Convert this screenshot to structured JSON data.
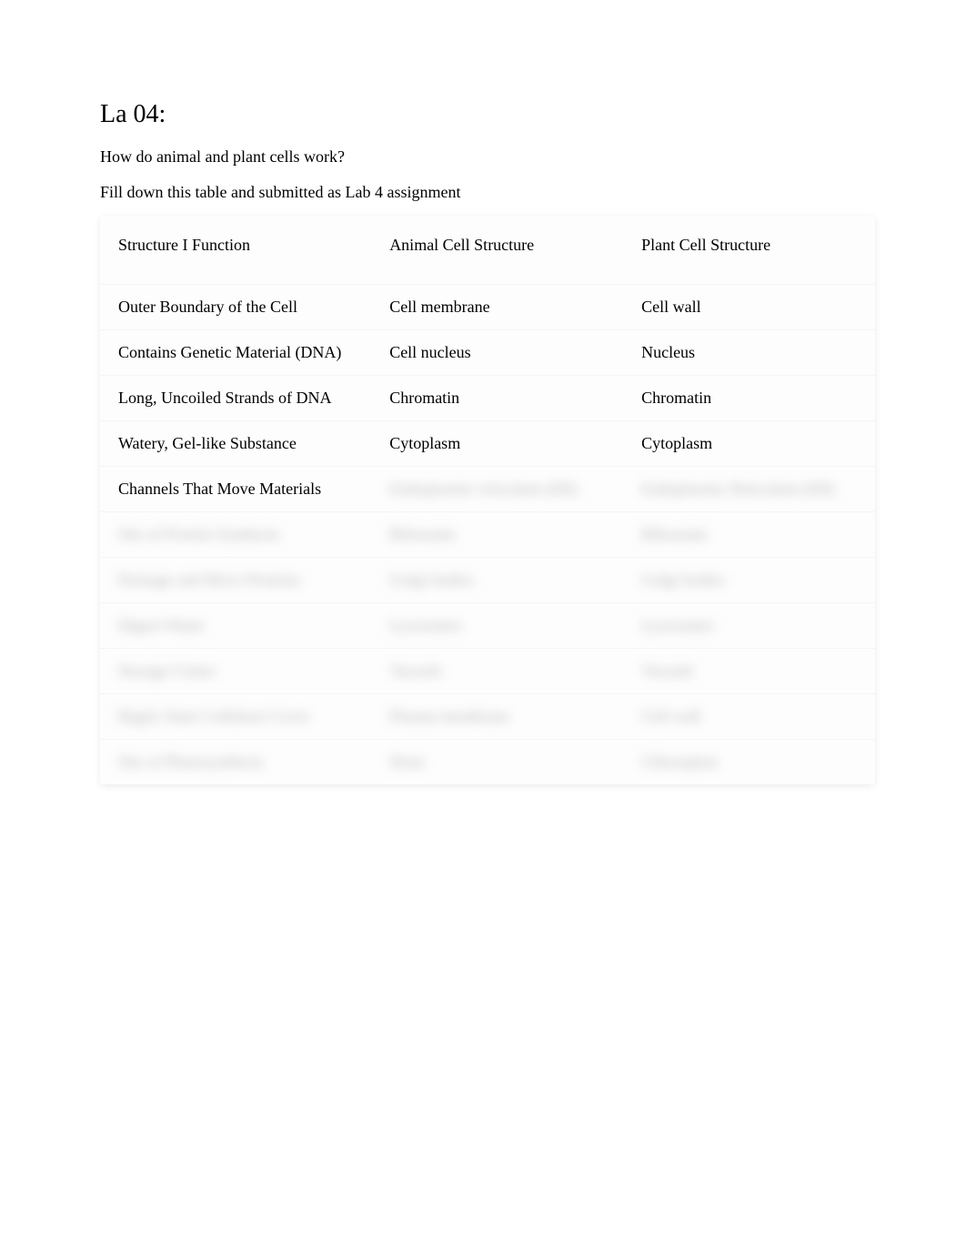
{
  "title": "La 04:",
  "subtitle": "How do animal and plant cells work?",
  "instruction": "Fill down this table and submitted as Lab 4 assignment",
  "table": {
    "headers": {
      "col1": "Structure   I Function",
      "col2": "Animal Cell Structure",
      "col3": "Plant Cell Structure"
    },
    "rows": [
      {
        "function": "Outer Boundary of the Cell",
        "animal": "Cell membrane",
        "plant": "Cell wall",
        "blurred": false
      },
      {
        "function": "Contains Genetic Material (DNA)",
        "animal": "Cell nucleus",
        "plant": "Nucleus",
        "blurred": false
      },
      {
        "function": "Long, Uncoiled Strands of DNA",
        "animal": "Chromatin",
        "plant": "Chromatin",
        "blurred": false
      },
      {
        "function": "Watery, Gel-like Substance",
        "animal": "Cytoplasm",
        "plant": "Cytoplasm",
        "blurred": false
      },
      {
        "function": "Channels That Move Materials",
        "animal": "Endoplasmic reticulum (ER)",
        "plant": "Endoplasmic Reticulum (ER)",
        "blurred": "partial"
      },
      {
        "function": "Site of Protein Synthesis",
        "animal": "Ribosome",
        "plant": "Ribosome",
        "blurred": true
      },
      {
        "function": "Package and Move Proteins",
        "animal": "Golgi bodies",
        "plant": "Golgi bodies",
        "blurred": true
      },
      {
        "function": "Digest Waste",
        "animal": "Lysosomes",
        "plant": "Lysosomes",
        "blurred": true
      },
      {
        "function": "Storage Center",
        "animal": "Vacuole",
        "plant": "Vacuole",
        "blurred": true
      },
      {
        "function": "Rigid, Outer Cellulose Cover",
        "animal": "Plasma membrane",
        "plant": "Cell wall",
        "blurred": true
      },
      {
        "function": "Site of Photosynthesis",
        "animal": "None",
        "plant": "Chloroplast",
        "blurred": true
      }
    ]
  }
}
